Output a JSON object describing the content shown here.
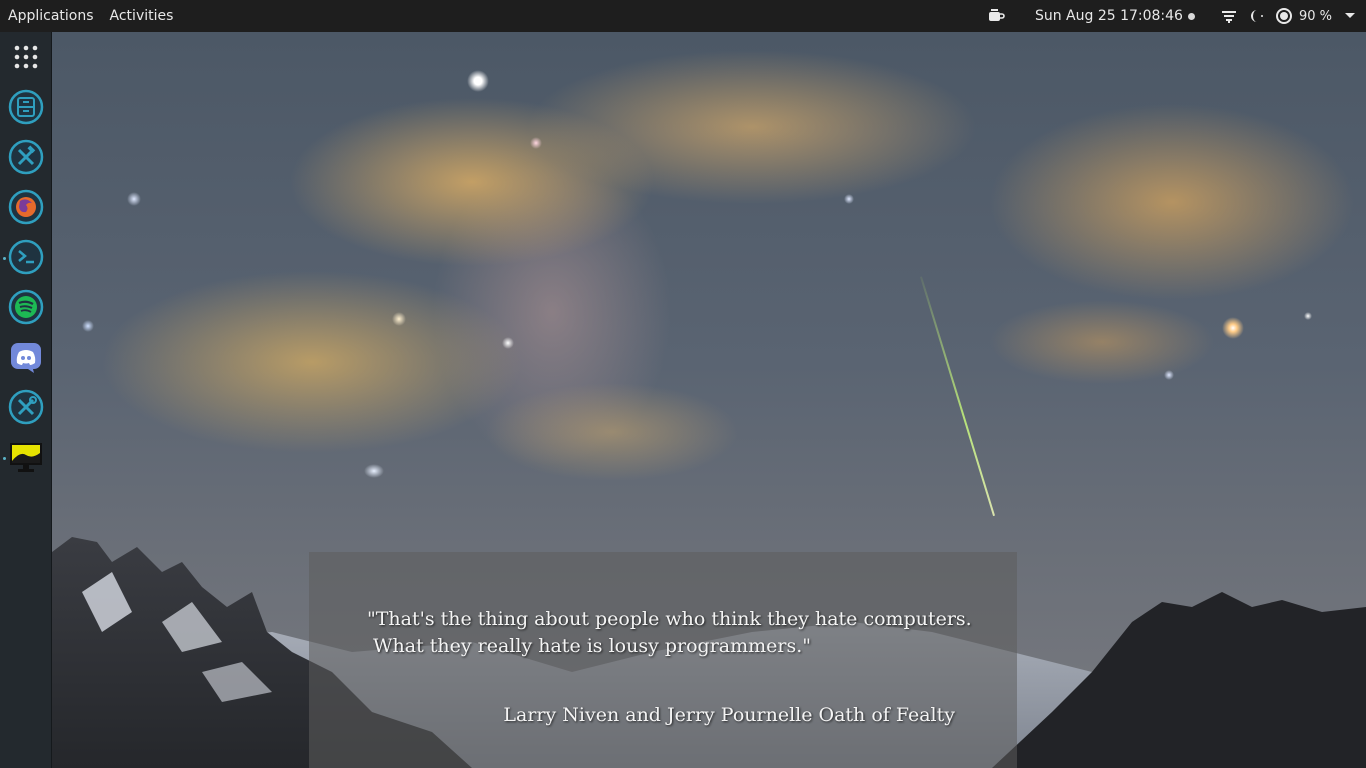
{
  "topbar": {
    "applications_label": "Applications",
    "activities_label": "Activities",
    "clock": "Sun Aug 25  17:08:46",
    "battery_percent": "90 %",
    "icons": [
      "coffee-cup-icon",
      "clock-dot-icon",
      "network-icon",
      "night-light-icon",
      "battery-ring-icon",
      "menu-arrow-icon"
    ]
  },
  "dock": {
    "items": [
      {
        "name": "show-apps",
        "icon": "grid-dots-icon"
      },
      {
        "name": "files",
        "icon": "file-cabinet-icon"
      },
      {
        "name": "tweaks",
        "icon": "hammer-wrench-icon"
      },
      {
        "name": "firefox",
        "icon": "firefox-icon"
      },
      {
        "name": "terminal",
        "icon": "terminal-icon"
      },
      {
        "name": "spotify",
        "icon": "spotify-icon"
      },
      {
        "name": "discord",
        "icon": "discord-icon"
      },
      {
        "name": "settings-tools",
        "icon": "tools-icon"
      },
      {
        "name": "display-settings",
        "icon": "monitor-icon"
      }
    ],
    "accent_color": "#2f9fbf"
  },
  "desktop": {
    "quote": {
      "line1": "\"That's the thing about people who think they hate computers.",
      "line2": "What they really hate is lousy programmers.\"",
      "author": "Larry Niven and Jerry Pournelle Oath of Fealty"
    }
  }
}
